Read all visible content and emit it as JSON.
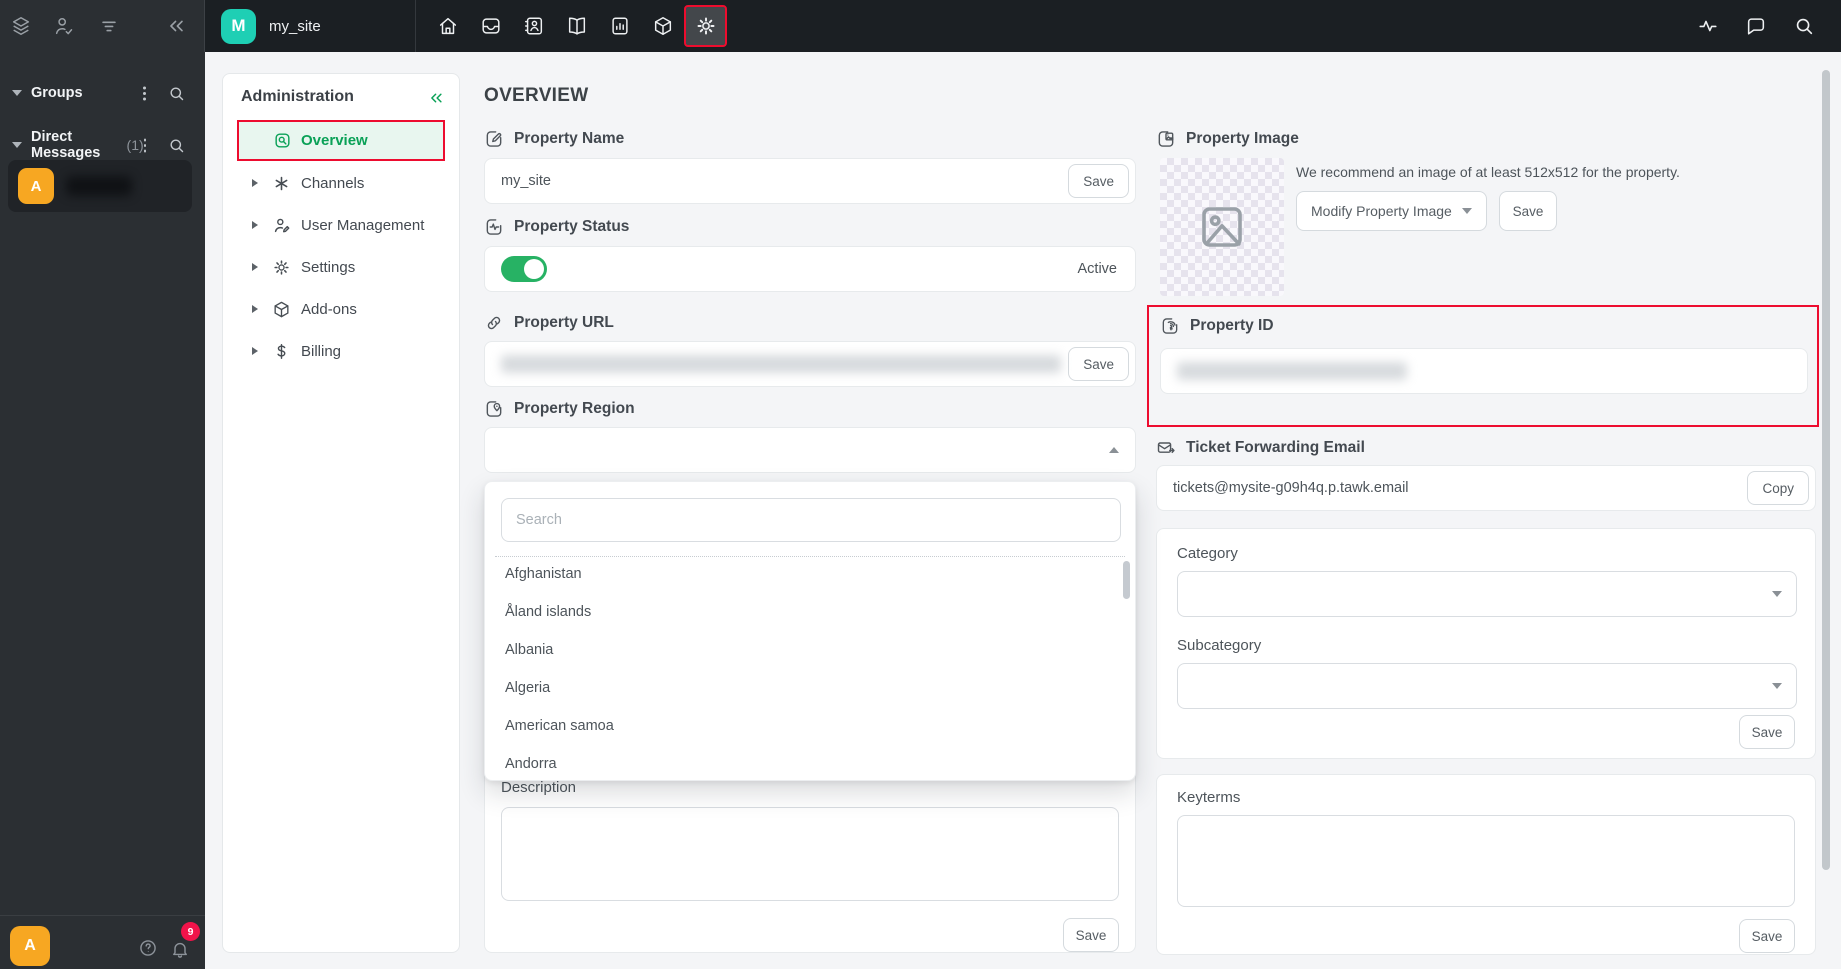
{
  "topbar": {
    "workspace_initial": "M",
    "workspace_name": "my_site",
    "nav_icons": [
      "home",
      "inbox",
      "contacts",
      "knowledge-base",
      "reporting",
      "add-ons",
      "settings"
    ],
    "right_icons": [
      "activity",
      "messages",
      "search"
    ]
  },
  "sidebar": {
    "groups_label": "Groups",
    "dm_label": "Direct Messages",
    "dm_count": "(1)",
    "dm_avatar_initial": "A",
    "user_avatar_initial": "A",
    "notification_count": "9"
  },
  "admin": {
    "title": "Administration",
    "items": {
      "overview": "Overview",
      "channels": "Channels",
      "user_management": "User Management",
      "settings": "Settings",
      "addons": "Add-ons",
      "billing": "Billing"
    }
  },
  "overview": {
    "page_title": "OVERVIEW",
    "property_name": {
      "label": "Property Name",
      "value": "my_site",
      "save": "Save"
    },
    "property_status": {
      "label": "Property Status",
      "value": "Active"
    },
    "property_url": {
      "label": "Property URL",
      "save": "Save"
    },
    "property_region": {
      "label": "Property Region",
      "search_placeholder": "Search",
      "options": [
        "Afghanistan",
        "Åland islands",
        "Albania",
        "Algeria",
        "American samoa",
        "Andorra"
      ]
    },
    "description": {
      "label": "Description",
      "save": "Save"
    },
    "property_image": {
      "label": "Property Image",
      "hint": "We recommend an image of at least 512x512 for the property.",
      "modify_button": "Modify Property Image",
      "save": "Save"
    },
    "property_id": {
      "label": "Property ID"
    },
    "ticket_email": {
      "label": "Ticket Forwarding Email",
      "value": "tickets@mysite-g09h4q.p.tawk.email",
      "copy": "Copy"
    },
    "category": {
      "label": "Category",
      "subcategory_label": "Subcategory",
      "save": "Save"
    },
    "keyterms": {
      "label": "Keyterms",
      "save": "Save"
    }
  },
  "colors": {
    "accent_green": "#0aa157",
    "workspace_teal": "#1ecfb4",
    "annotation_red": "#ed0c2f",
    "toggle_green": "#27b264",
    "badge_red": "#f1134a",
    "online_green": "#2ecc40",
    "avatar_orange": "#f7a722",
    "topbar_dark": "#1b1f23",
    "sidebar_dark": "#2b2f33"
  }
}
